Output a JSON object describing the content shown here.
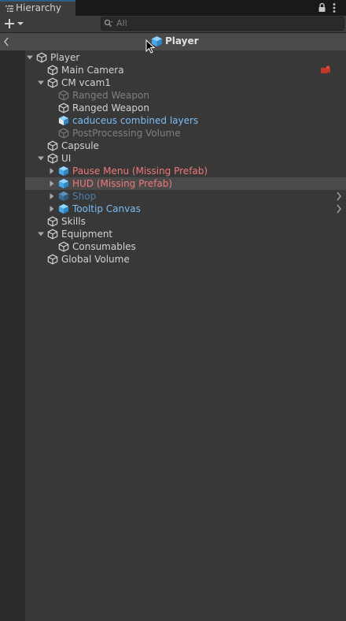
{
  "window": {
    "tab_title": "Hierarchy",
    "search": {
      "placeholder": "All",
      "value": ""
    }
  },
  "scene_header": {
    "title": "Player"
  },
  "rows": [
    {
      "label": "Player",
      "depth": 0,
      "fold": "open",
      "icon": "gameobject-icon",
      "style": "normal"
    },
    {
      "label": "Main Camera",
      "depth": 1,
      "fold": "none",
      "icon": "gameobject-icon",
      "style": "normal",
      "badge": "recording-icon"
    },
    {
      "label": "CM vcam1",
      "depth": 1,
      "fold": "open",
      "icon": "gameobject-icon",
      "style": "normal"
    },
    {
      "label": "Ranged Weapon",
      "depth": 2,
      "fold": "none",
      "icon": "gameobject-icon",
      "style": "disabled"
    },
    {
      "label": "Ranged Weapon",
      "depth": 2,
      "fold": "none",
      "icon": "gameobject-icon",
      "style": "normal"
    },
    {
      "label": "caduceus combined layers",
      "depth": 2,
      "fold": "none",
      "icon": "prefab-variant-icon",
      "style": "prefab"
    },
    {
      "label": "PostProcessing Volume",
      "depth": 2,
      "fold": "none",
      "icon": "gameobject-icon",
      "style": "disabled"
    },
    {
      "label": "Capsule",
      "depth": 1,
      "fold": "none",
      "icon": "gameobject-icon",
      "style": "normal"
    },
    {
      "label": "UI",
      "depth": 1,
      "fold": "open",
      "icon": "gameobject-icon",
      "style": "normal"
    },
    {
      "label": "Pause Menu (Missing Prefab)",
      "depth": 2,
      "fold": "closed",
      "icon": "prefab-icon",
      "style": "missing"
    },
    {
      "label": "HUD (Missing Prefab)",
      "depth": 2,
      "fold": "closed",
      "icon": "prefab-icon",
      "style": "missing",
      "selected": true
    },
    {
      "label": "Shop",
      "depth": 2,
      "fold": "closed",
      "icon": "prefab-icon",
      "style": "prefab-disabled",
      "chevron": true
    },
    {
      "label": "Tooltip Canvas",
      "depth": 2,
      "fold": "closed",
      "icon": "prefab-icon",
      "style": "prefab",
      "chevron": true
    },
    {
      "label": "Skills",
      "depth": 1,
      "fold": "none",
      "icon": "gameobject-icon",
      "style": "normal"
    },
    {
      "label": "Equipment",
      "depth": 1,
      "fold": "open",
      "icon": "gameobject-icon",
      "style": "normal"
    },
    {
      "label": "Consumables",
      "depth": 2,
      "fold": "none",
      "icon": "gameobject-icon",
      "style": "normal"
    },
    {
      "label": "Global Volume",
      "depth": 1,
      "fold": "none",
      "icon": "gameobject-icon",
      "style": "normal"
    }
  ],
  "colors": {
    "normal": "#d2d2d2",
    "disabled": "#7f7f7f",
    "prefab": "#7bbcf5",
    "missing": "#f07878",
    "prefab_disabled": "#4f7ea8",
    "selection": "#4a4a4a"
  }
}
